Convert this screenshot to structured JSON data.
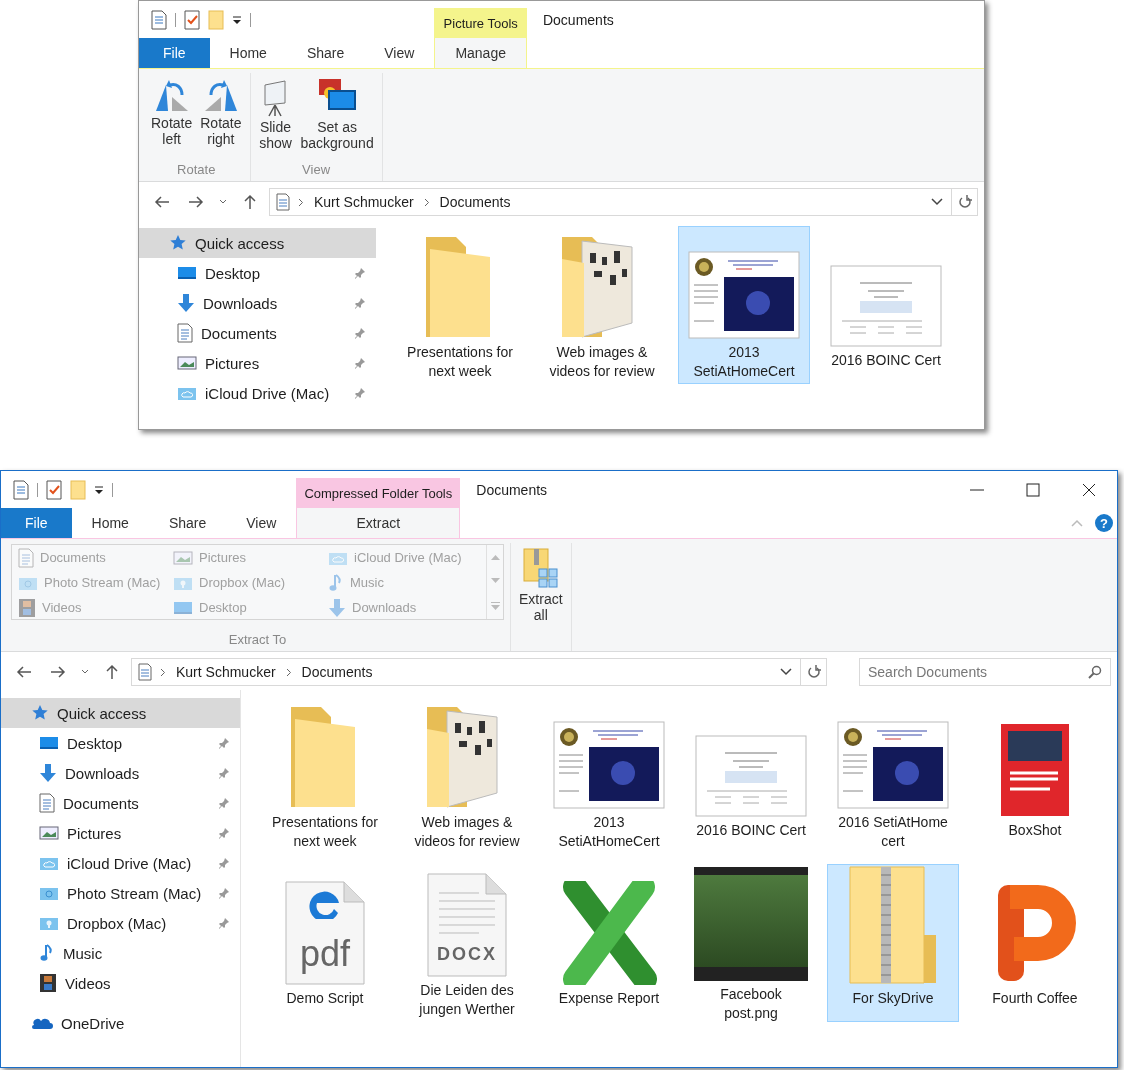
{
  "windows": [
    {
      "title": "Documents",
      "context_tab": {
        "label": "Picture Tools",
        "color": "#f4f48c"
      },
      "tabs": [
        {
          "label": "File",
          "kind": "file",
          "selected": false
        },
        {
          "label": "Home",
          "kind": "tab",
          "selected": false
        },
        {
          "label": "Share",
          "kind": "tab",
          "selected": false
        },
        {
          "label": "View",
          "kind": "tab",
          "selected": false
        },
        {
          "label": "Manage",
          "kind": "context",
          "selected": true
        }
      ],
      "ribbon_groups": [
        {
          "label": "Rotate",
          "kind": "buttons",
          "buttons": [
            {
              "label": "Rotate\nleft",
              "kind": "rotate-left"
            },
            {
              "label": "Rotate\nright",
              "kind": "rotate-right"
            }
          ]
        },
        {
          "label": "View",
          "kind": "buttons",
          "buttons": [
            {
              "label": "Slide\nshow",
              "kind": "slideshow"
            },
            {
              "label": "Set as\nbackground",
              "kind": "background"
            }
          ]
        }
      ],
      "address": {
        "path": [
          "Kurt Schmucker",
          "Documents"
        ]
      },
      "navigation": [
        {
          "label": "Quick access",
          "kind": "star",
          "selected": true,
          "children": [
            {
              "label": "Desktop",
              "kind": "desktop",
              "pinned": true
            },
            {
              "label": "Downloads",
              "kind": "download",
              "pinned": true
            },
            {
              "label": "Documents",
              "kind": "document",
              "pinned": true
            },
            {
              "label": "Pictures",
              "kind": "pictures",
              "pinned": true
            },
            {
              "label": "iCloud Drive (Mac)",
              "kind": "cloud-folder",
              "pinned": true
            }
          ]
        }
      ],
      "files": [
        {
          "label": "Presentations for\nnext week",
          "kind": "folder",
          "selected": false
        },
        {
          "label": "Web images &\nvideos for review",
          "kind": "image-folder",
          "selected": false
        },
        {
          "label": "2013\nSetiAtHomeCert",
          "kind": "certificate",
          "selected": true
        },
        {
          "label": "2016 BOINC Cert",
          "kind": "certificate-plain",
          "selected": false
        }
      ]
    },
    {
      "title": "Documents",
      "context_tab": {
        "label": "Compressed Folder Tools",
        "color": "#f9c6e2"
      },
      "window_buttons": [
        {
          "kind": "minimize"
        },
        {
          "kind": "maximize"
        },
        {
          "kind": "close"
        }
      ],
      "ribbon_collapse": true,
      "help": "?",
      "tabs": [
        {
          "label": "File",
          "kind": "file",
          "selected": false
        },
        {
          "label": "Home",
          "kind": "tab",
          "selected": false
        },
        {
          "label": "Share",
          "kind": "tab",
          "selected": false
        },
        {
          "label": "View",
          "kind": "tab",
          "selected": false
        },
        {
          "label": "Extract",
          "kind": "context",
          "selected": true
        }
      ],
      "ribbon_groups": [
        {
          "label": "Extract To",
          "kind": "gallery",
          "items": [
            {
              "label": "Documents",
              "kind": "document",
              "disabled": true
            },
            {
              "label": "Pictures",
              "kind": "pictures",
              "disabled": true
            },
            {
              "label": "iCloud Drive (Mac)",
              "kind": "cloud-folder",
              "disabled": true
            },
            {
              "label": "Photo Stream (Mac)",
              "kind": "photo-folder",
              "disabled": true
            },
            {
              "label": "Dropbox (Mac)",
              "kind": "dropbox-folder",
              "disabled": true
            },
            {
              "label": "Music",
              "kind": "music",
              "disabled": true
            },
            {
              "label": "Videos",
              "kind": "videos",
              "disabled": true
            },
            {
              "label": "Desktop",
              "kind": "desktop",
              "disabled": true
            },
            {
              "label": "Downloads",
              "kind": "download",
              "disabled": true
            }
          ]
        },
        {
          "kind": "buttons",
          "buttons": [
            {
              "label": "Extract\nall",
              "kind": "extract"
            }
          ]
        }
      ],
      "address": {
        "path": [
          "Kurt Schmucker",
          "Documents"
        ],
        "search_placeholder": "Search Documents"
      },
      "navigation": [
        {
          "label": "Quick access",
          "kind": "star",
          "selected": true,
          "children": [
            {
              "label": "Desktop",
              "kind": "desktop",
              "pinned": true
            },
            {
              "label": "Downloads",
              "kind": "download",
              "pinned": true
            },
            {
              "label": "Documents",
              "kind": "document",
              "pinned": true
            },
            {
              "label": "Pictures",
              "kind": "pictures",
              "pinned": true
            },
            {
              "label": "iCloud Drive (Mac)",
              "kind": "cloud-folder",
              "pinned": true
            },
            {
              "label": "Photo Stream (Mac)",
              "kind": "photo-folder",
              "pinned": true
            },
            {
              "label": "Dropbox (Mac)",
              "kind": "dropbox-folder",
              "pinned": true
            },
            {
              "label": "Music",
              "kind": "music",
              "pinned": false
            },
            {
              "label": "Videos",
              "kind": "videos",
              "pinned": false
            }
          ]
        },
        {
          "label": "OneDrive",
          "kind": "onedrive",
          "selected": false
        }
      ],
      "files": [
        {
          "label": "Presentations for\nnext week",
          "kind": "folder",
          "selected": false
        },
        {
          "label": "Web images &\nvideos for review",
          "kind": "image-folder",
          "selected": false
        },
        {
          "label": "2013\nSetiAtHomeCert",
          "kind": "certificate",
          "selected": false
        },
        {
          "label": "2016 BOINC Cert",
          "kind": "certificate-plain",
          "selected": false
        },
        {
          "label": "2016 SetiAtHome\ncert",
          "kind": "certificate",
          "selected": false
        },
        {
          "label": "BoxShot",
          "kind": "boxshot",
          "selected": false
        },
        {
          "label": "Demo Script",
          "kind": "pdf",
          "badge": "pdf",
          "selected": false
        },
        {
          "label": "Die Leiden des\njungen Werther",
          "kind": "docx",
          "badge": "DOCX",
          "selected": false
        },
        {
          "label": "Expense Report",
          "kind": "spreadsheet",
          "selected": false
        },
        {
          "label": "Facebook\npost.png",
          "kind": "photo",
          "selected": false
        },
        {
          "label": "For SkyDrive",
          "kind": "zip-folder",
          "selected": true
        },
        {
          "label": "Fourth Coffee",
          "kind": "presentation",
          "selected": false
        }
      ]
    }
  ]
}
